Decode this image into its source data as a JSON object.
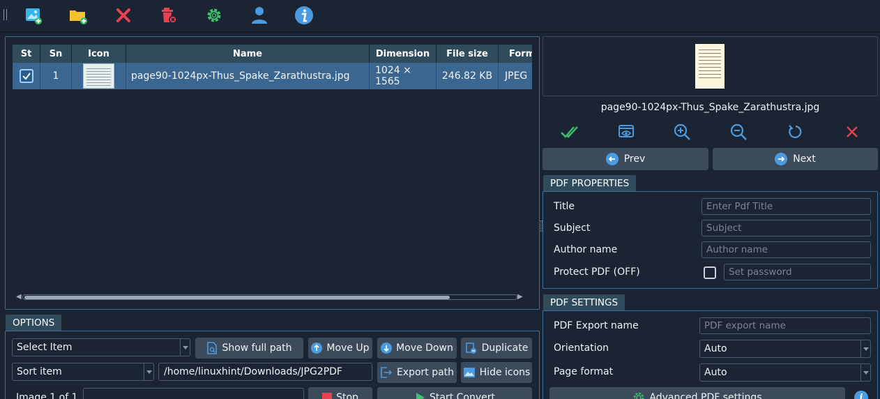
{
  "toolbar": {
    "buttons": [
      {
        "name": "add-image-icon",
        "tooltip": "Add images"
      },
      {
        "name": "add-folder-icon",
        "tooltip": "Add folder"
      },
      {
        "name": "remove-icon",
        "tooltip": "Remove"
      },
      {
        "name": "clear-all-icon",
        "tooltip": "Clear all"
      },
      {
        "name": "settings-icon",
        "tooltip": "Settings"
      },
      {
        "name": "user-icon",
        "tooltip": "User"
      },
      {
        "name": "info-icon",
        "tooltip": "About"
      }
    ]
  },
  "table": {
    "columns": [
      "St",
      "Sn",
      "Icon",
      "Name",
      "Dimension",
      "File size",
      "Form"
    ],
    "rows": [
      {
        "checked": true,
        "sn": "1",
        "name": "page90-1024px-Thus_Spake_Zarathustra.jpg",
        "dimension_line1": "1024 ×",
        "dimension_line2": "1565",
        "file_size": "246.82 KB",
        "format": "JPEG"
      }
    ]
  },
  "preview": {
    "filename": "page90-1024px-Thus_Spake_Zarathustra.jpg",
    "prev_label": "Prev",
    "next_label": "Next"
  },
  "pdf_properties": {
    "title": "PDF PROPERTIES",
    "title_label": "Title",
    "title_placeholder": "Enter Pdf Title",
    "subject_label": "Subject",
    "subject_placeholder": "Subject",
    "author_label": "Author name",
    "author_placeholder": "Author name",
    "protect_label": "Protect PDF (OFF)",
    "protect_checked": false,
    "password_placeholder": "Set password"
  },
  "pdf_settings": {
    "title": "PDF SETTINGS",
    "export_name_label": "PDF Export name",
    "export_name_placeholder": "PDF export name",
    "orientation_label": "Orientation",
    "orientation_value": "Auto",
    "page_format_label": "Page format",
    "page_format_value": "Auto",
    "advanced_label": "Advanced PDF settings"
  },
  "options": {
    "title": "OPTIONS",
    "select_item": "Select Item",
    "sort_item": "Sort item",
    "path": "/home/linuxhint/Downloads/JPG2PDF",
    "show_full_path": "Show full path",
    "move_up": "Move Up",
    "move_down": "Move Down",
    "duplicate": "Duplicate",
    "export_path": "Export path",
    "hide_icons": "Hide icons",
    "image_count": "Image 1 of 1",
    "stop": "Stop",
    "start_convert": "Start Convert"
  },
  "colors": {
    "background": "#1b2432",
    "header": "#2f4b5c",
    "selected_row": "#3b668f",
    "button": "#3c4b5c",
    "accent_blue": "#4b9be0",
    "accent_green": "#3fc06a",
    "accent_red": "#e8414f"
  }
}
